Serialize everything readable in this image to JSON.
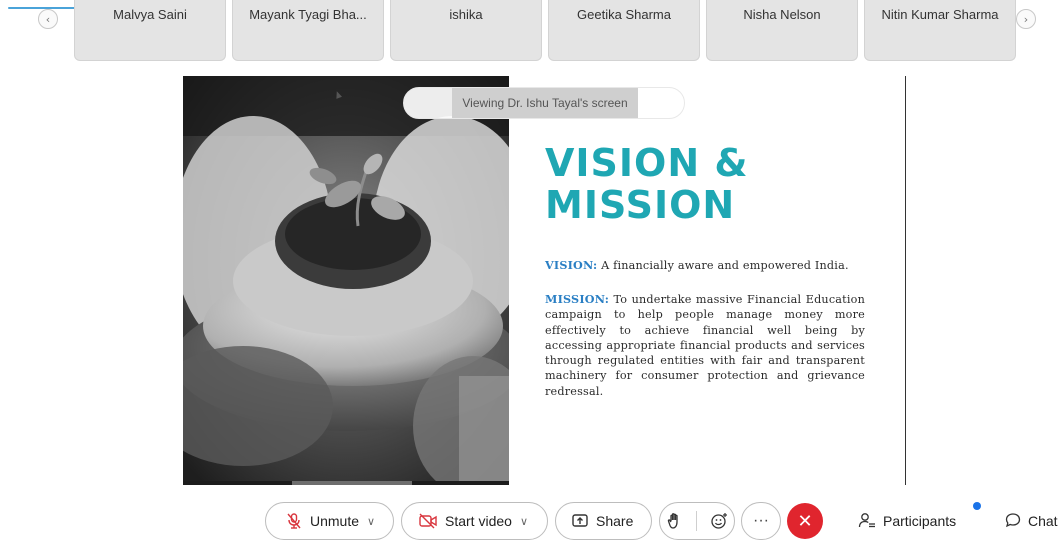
{
  "participants": {
    "prev_arrow": "‹",
    "next_arrow": "›",
    "tiles": [
      {
        "name": "Malvya Saini"
      },
      {
        "name": "Mayank Tyagi Bha..."
      },
      {
        "name": "ishika"
      },
      {
        "name": "Geetika Sharma"
      },
      {
        "name": "Nisha Nelson"
      },
      {
        "name": "Nitin Kumar Sharma"
      }
    ]
  },
  "share": {
    "viewing_label": "Viewing Dr. Ishu Tayal's screen"
  },
  "slide": {
    "title_line1": "VISION &",
    "title_line2": "MISSION",
    "vision_label": "VISION:",
    "vision_text": " A financially aware and empowered India.",
    "mission_label": "MISSION:",
    "mission_text": " To undertake massive Financial Education campaign to help people manage money more effectively  to achieve financial well being by accessing appropriate  financial products and services through regulated entities  with fair and transparent machinery for consumer  protection and grievance redressal."
  },
  "controls": {
    "unmute_label": "Unmute",
    "start_video_label": "Start video",
    "share_label": "Share",
    "more_label": "···",
    "end_label": "✕",
    "participants_label": "Participants",
    "chat_label": "Chat",
    "chevron": "∨"
  },
  "colors": {
    "accent": "#1fa7b3",
    "label_blue": "#2a7fc4",
    "end_red": "#e0252e",
    "notify_blue": "#1a73e8",
    "mute_red": "#d9363e"
  },
  "icons": {
    "unmute": "microphone-muted-icon",
    "start_video": "camera-off-icon",
    "share": "share-screen-icon",
    "hand": "raise-hand-icon",
    "reaction": "emoji-reaction-icon",
    "participants": "participants-icon",
    "chat": "chat-bubble-icon"
  }
}
